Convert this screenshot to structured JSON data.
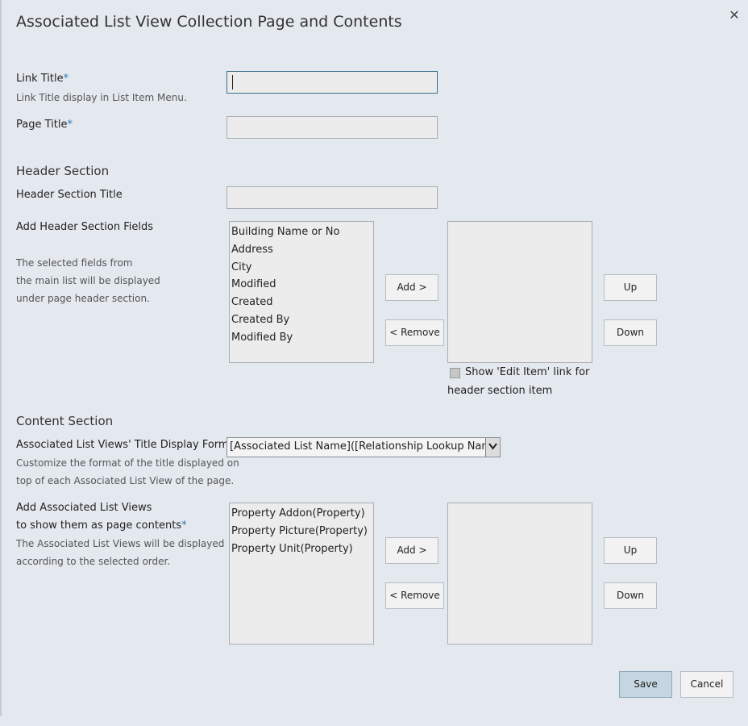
{
  "dialog": {
    "title": "Associated List View Collection Page and Contents",
    "close_glyph": "✕"
  },
  "link_title": {
    "label": "Link Title",
    "required_mark": "*",
    "help": "Link Title display in List Item Menu.",
    "value": ""
  },
  "page_title": {
    "label": "Page Title",
    "required_mark": "*",
    "value": ""
  },
  "header_section": {
    "heading": "Header Section",
    "title_label": "Header Section Title",
    "title_value": "",
    "fields_label": "Add Header Section Fields",
    "fields_help": [
      "The selected fields from",
      "the main list will be displayed",
      "under page header section."
    ],
    "available_fields": [
      "Building Name or No",
      "Address",
      "City",
      "Modified",
      "Created",
      "Created By",
      "Modified By"
    ],
    "add_button": "Add >",
    "remove_button": "< Remove",
    "up_button": "Up",
    "down_button": "Down",
    "show_edit_label_line1": "Show 'Edit Item' link for",
    "show_edit_label_line2": "header section item",
    "show_edit_checked": false
  },
  "content_section": {
    "heading": "Content Section",
    "format_label": "Associated List Views' Title Display Format",
    "required_mark": "*",
    "format_help": [
      "Customize the format of the title displayed on",
      "top of each Associated List View of the page."
    ],
    "format_selected": "[Associated List Name]([Relationship Lookup Name])",
    "views_label_line1": "Add Associated List Views",
    "views_label_line2": "to show them as page contents",
    "views_required_mark": "*",
    "views_help": [
      "The Associated List Views will be displayed",
      "according to the selected order."
    ],
    "available_views": [
      "Property Addon(Property)",
      "Property Picture(Property)",
      "Property Unit(Property)"
    ],
    "add_button": "Add >",
    "remove_button": "< Remove",
    "up_button": "Up",
    "down_button": "Down"
  },
  "footer": {
    "save_label": "Save",
    "cancel_label": "Cancel"
  },
  "colors": {
    "background": "#e4e8ef",
    "required_mark": "#2a7ab0",
    "save_button": "#c5d6e2"
  }
}
